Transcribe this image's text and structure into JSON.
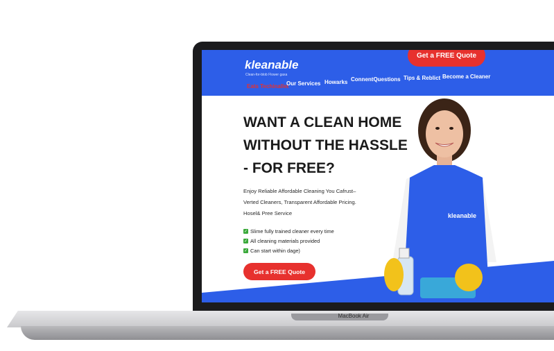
{
  "device": {
    "label": "MacBook Air"
  },
  "site": {
    "logo": "kleanable",
    "tagline": "Clean-for-blob Flower gaxa",
    "cta_top": "Get a FREE Quote",
    "nav": [
      {
        "label": "Eats Techinallet",
        "color": "#e7312e"
      },
      {
        "label": "Our Services"
      },
      {
        "label": "Howarks"
      },
      {
        "label": "ConnentQuestions"
      },
      {
        "label": "Tips & Reblict"
      },
      {
        "label": "Become a Cleaner"
      }
    ]
  },
  "hero": {
    "title_lines": [
      "WANT A CLEAN HOME",
      "WITHOUT THE HASSLE",
      "- FOR FREE?"
    ],
    "subtitle_lines": [
      "Enjoy Reliable Affordable Cleaning You Cafrust–",
      "Verted Cleaners, Transparent Affordable Pricing.",
      "Hosel& Pree Service"
    ],
    "features": [
      "Slime fully trained cleaner every time",
      "All cleaning materials provided",
      "Can start within dage)"
    ],
    "cta": "Get a FREE Quote",
    "apron_logo": "kleanable"
  },
  "colors": {
    "brand_blue": "#2d5ee8",
    "cta_red": "#e7312e",
    "check_green": "#3aa93a"
  }
}
